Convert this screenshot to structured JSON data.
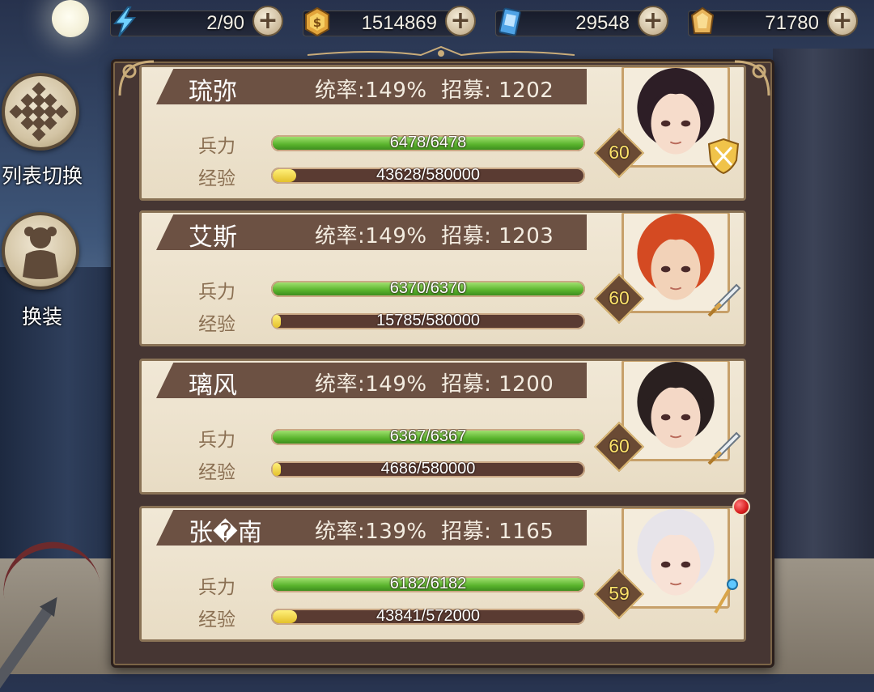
{
  "resources": [
    {
      "icon": "energy-bolt-icon",
      "value": "2/90"
    },
    {
      "icon": "gold-coin-icon",
      "value": "1514869"
    },
    {
      "icon": "blue-card-icon",
      "value": "29548"
    },
    {
      "icon": "amber-gem-icon",
      "value": "71780"
    }
  ],
  "side_buttons": [
    {
      "label": "列表切换",
      "icon": "grid-dots-icon"
    },
    {
      "label": "换装",
      "icon": "outfit-icon"
    }
  ],
  "labels": {
    "troops": "兵力",
    "exp": "经验"
  },
  "heroes": [
    {
      "name": "琉弥",
      "stats": "统率:149%  招募: 1202",
      "troops": "6478/6478",
      "troops_fraction": 1.0,
      "exp": "43628/580000",
      "exp_fraction": 0.075,
      "level": "60",
      "class_icon": "shield-sword-icon",
      "hair": "#2d1e26",
      "skin": "#f6dccb",
      "has_alert": false
    },
    {
      "name": "艾斯",
      "stats": "统率:149%  招募: 1203",
      "troops": "6370/6370",
      "troops_fraction": 1.0,
      "exp": "15785/580000",
      "exp_fraction": 0.027,
      "level": "60",
      "class_icon": "sword-icon",
      "hair": "#d44a22",
      "skin": "#f2d2b8",
      "has_alert": false
    },
    {
      "name": "璃风",
      "stats": "统率:149%  招募: 1200",
      "troops": "6367/6367",
      "troops_fraction": 1.0,
      "exp": "4686/580000",
      "exp_fraction": 0.008,
      "level": "60",
      "class_icon": "sword-icon",
      "hair": "#2a2020",
      "skin": "#f4d8c6",
      "has_alert": false
    },
    {
      "name": "张�南",
      "stats": "统率:139%  招募: 1165",
      "troops": "6182/6182",
      "troops_fraction": 1.0,
      "exp": "43841/572000",
      "exp_fraction": 0.077,
      "level": "59",
      "class_icon": "staff-icon",
      "hair": "#e7e4ea",
      "skin": "#f8e2d6",
      "has_alert": true
    }
  ],
  "colors": {
    "panel": "#463633",
    "card": "#f1e8d6",
    "name_bar": "#6c5143",
    "troop_fill": "#59b32c",
    "exp_fill": "#e4c12b",
    "level_text": "#ffe36b"
  }
}
